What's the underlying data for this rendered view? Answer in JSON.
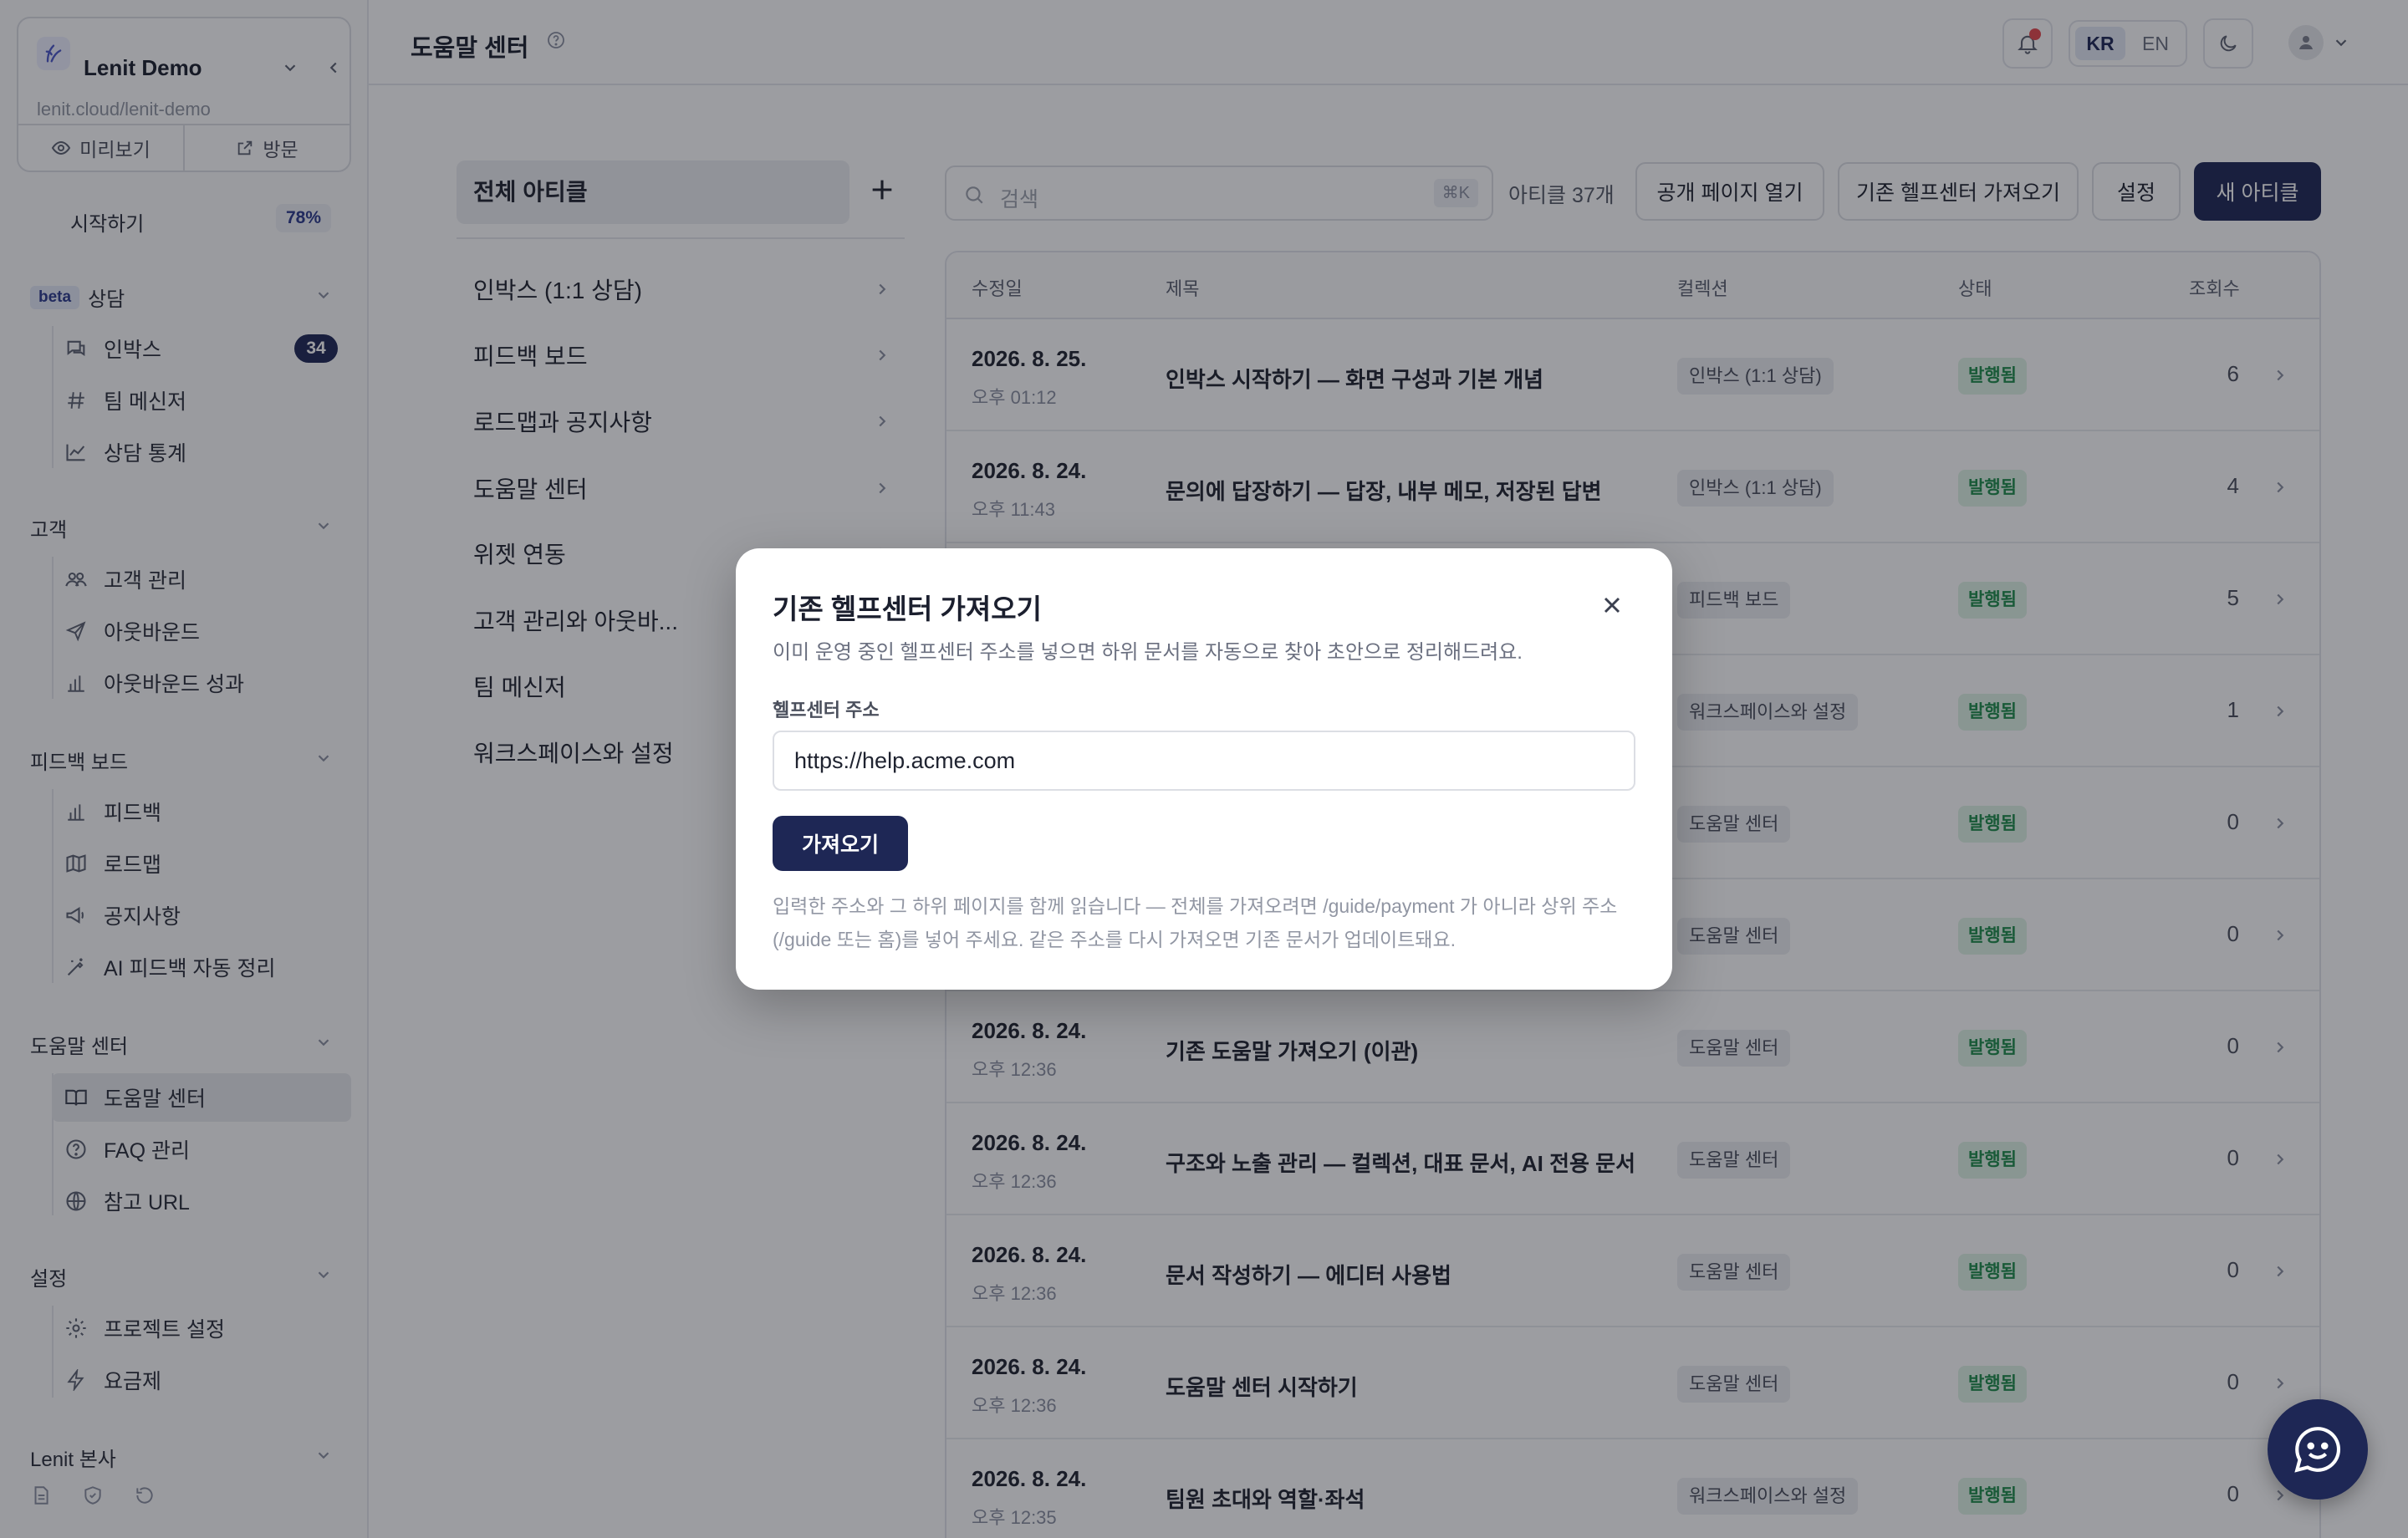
{
  "workspace": {
    "name": "Lenit Demo",
    "url": "lenit.cloud/lenit-demo",
    "preview_label": "미리보기",
    "visit_label": "방문"
  },
  "sidebar": {
    "start": {
      "label": "시작하기",
      "progress": "78%"
    },
    "sections": [
      {
        "badge": "beta",
        "title": "상담",
        "items": [
          {
            "label": "인박스",
            "icon": "inbox-chat-icon",
            "count": "34"
          },
          {
            "label": "팀 메신저",
            "icon": "hash-icon"
          },
          {
            "label": "상담 통계",
            "icon": "chart-line-icon"
          }
        ]
      },
      {
        "title": "고객",
        "items": [
          {
            "label": "고객 관리",
            "icon": "users-icon"
          },
          {
            "label": "아웃바운드",
            "icon": "send-icon"
          },
          {
            "label": "아웃바운드 성과",
            "icon": "bar-chart-icon"
          }
        ]
      },
      {
        "title": "피드백 보드",
        "items": [
          {
            "label": "피드백",
            "icon": "bar-chart-icon"
          },
          {
            "label": "로드맵",
            "icon": "map-icon"
          },
          {
            "label": "공지사항",
            "icon": "megaphone-icon"
          },
          {
            "label": "AI 피드백 자동 정리",
            "icon": "magic-icon"
          }
        ]
      },
      {
        "title": "도움말 센터",
        "items": [
          {
            "label": "도움말 센터",
            "icon": "book-icon",
            "active": true
          },
          {
            "label": "FAQ 관리",
            "icon": "question-icon"
          },
          {
            "label": "참고 URL",
            "icon": "globe-icon"
          }
        ]
      },
      {
        "title": "설정",
        "items": [
          {
            "label": "프로젝트 설정",
            "icon": "gear-icon"
          },
          {
            "label": "요금제",
            "icon": "bolt-icon"
          }
        ]
      },
      {
        "title": "Lenit 본사",
        "items": []
      }
    ]
  },
  "topbar": {
    "title": "도움말 센터",
    "lang_kr": "KR",
    "lang_en": "EN"
  },
  "collections": {
    "all_label": "전체 아티클",
    "items": [
      "인박스 (1:1 상담)",
      "피드백 보드",
      "로드맵과 공지사항",
      "도움말 센터",
      "위젯 연동",
      "고객 관리와 아웃바...",
      "팀 메신저",
      "워크스페이스와 설정"
    ]
  },
  "toolbar": {
    "search_placeholder": "검색",
    "search_shortcut": "⌘K",
    "article_count": "아티클 37개",
    "open_public": "공개 페이지 열기",
    "import_existing": "기존 헬프센터 가져오기",
    "settings": "설정",
    "new_article": "새 아티클"
  },
  "table": {
    "headers": {
      "modified": "수정일",
      "title": "제목",
      "collection": "컬렉션",
      "status": "상태",
      "views": "조회수"
    },
    "rows": [
      {
        "date": "2026. 8. 25.",
        "time": "오후 01:12",
        "title": "인박스 시작하기 — 화면 구성과 기본 개념",
        "collection": "인박스 (1:1 상담)",
        "status": "발행됨",
        "views": "6"
      },
      {
        "date": "2026. 8. 24.",
        "time": "오후 11:43",
        "title": "문의에 답장하기 — 답장, 내부 메모, 저장된 답변",
        "collection": "인박스 (1:1 상담)",
        "status": "발행됨",
        "views": "4"
      },
      {
        "date": "",
        "time": "",
        "title": "",
        "collection": "피드백 보드",
        "status": "발행됨",
        "views": "5"
      },
      {
        "date": "",
        "time": "",
        "title": "",
        "collection": "워크스페이스와 설정",
        "status": "발행됨",
        "views": "1"
      },
      {
        "date": "",
        "time": "",
        "title": "",
        "collection": "도움말 센터",
        "status": "발행됨",
        "views": "0"
      },
      {
        "date": "",
        "time": "",
        "title": "",
        "collection": "도움말 센터",
        "status": "발행됨",
        "views": "0"
      },
      {
        "date": "2026. 8. 24.",
        "time": "오후 12:36",
        "title": "기존 도움말 가져오기 (이관)",
        "collection": "도움말 센터",
        "status": "발행됨",
        "views": "0"
      },
      {
        "date": "2026. 8. 24.",
        "time": "오후 12:36",
        "title": "구조와 노출 관리 — 컬렉션, 대표 문서, AI 전용 문서",
        "collection": "도움말 센터",
        "status": "발행됨",
        "views": "0"
      },
      {
        "date": "2026. 8. 24.",
        "time": "오후 12:36",
        "title": "문서 작성하기 — 에디터 사용법",
        "collection": "도움말 센터",
        "status": "발행됨",
        "views": "0"
      },
      {
        "date": "2026. 8. 24.",
        "time": "오후 12:36",
        "title": "도움말 센터 시작하기",
        "collection": "도움말 센터",
        "status": "발행됨",
        "views": "0"
      },
      {
        "date": "2026. 8. 24.",
        "time": "오후 12:35",
        "title": "팀원 초대와 역할·좌석",
        "collection": "워크스페이스와 설정",
        "status": "발행됨",
        "views": "0"
      }
    ]
  },
  "modal": {
    "title": "기존 헬프센터 가져오기",
    "description": "이미 운영 중인 헬프센터 주소를 넣으면 하위 문서를 자동으로 찾아 초안으로 정리해드려요.",
    "field_label": "헬프센터 주소",
    "field_value": "https://help.acme.com",
    "submit": "가져오기",
    "note": "입력한 주소와 그 하위 페이지를 함께 읽습니다 — 전체를 가져오려면 /guide/payment 가 아니라 상위 주소(/guide 또는 홈)를 넣어 주세요. 같은 주소를 다시 가져오면 기존 문서가 업데이트돼요."
  },
  "colors": {
    "brand": "#1e2755",
    "status_green": "#1e8c4a",
    "notification": "#e5484d"
  }
}
